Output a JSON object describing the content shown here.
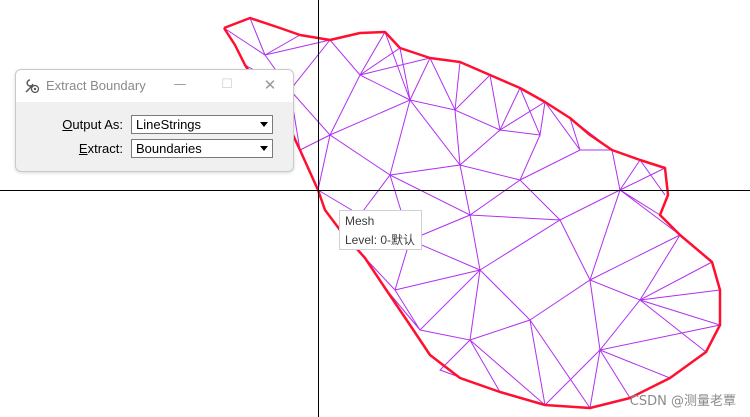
{
  "dialog": {
    "title": "Extract Boundary",
    "minimize_glyph": "—",
    "maximize_glyph": "☐",
    "close_glyph": "✕",
    "app_icon": "wrench-gear-icon",
    "output_as": {
      "label": "Output As:",
      "value": "LineStrings"
    },
    "extract": {
      "label": "Extract:",
      "value": "Boundaries"
    }
  },
  "tooltip": {
    "line1": "Mesh",
    "line2": "Level: 0-默认"
  },
  "watermark": "CSDN @测量老覃",
  "colors": {
    "mesh_edges": "#b030f0",
    "boundary": "#ff1030",
    "crosshair": "#000000",
    "background": "#ffffff"
  }
}
